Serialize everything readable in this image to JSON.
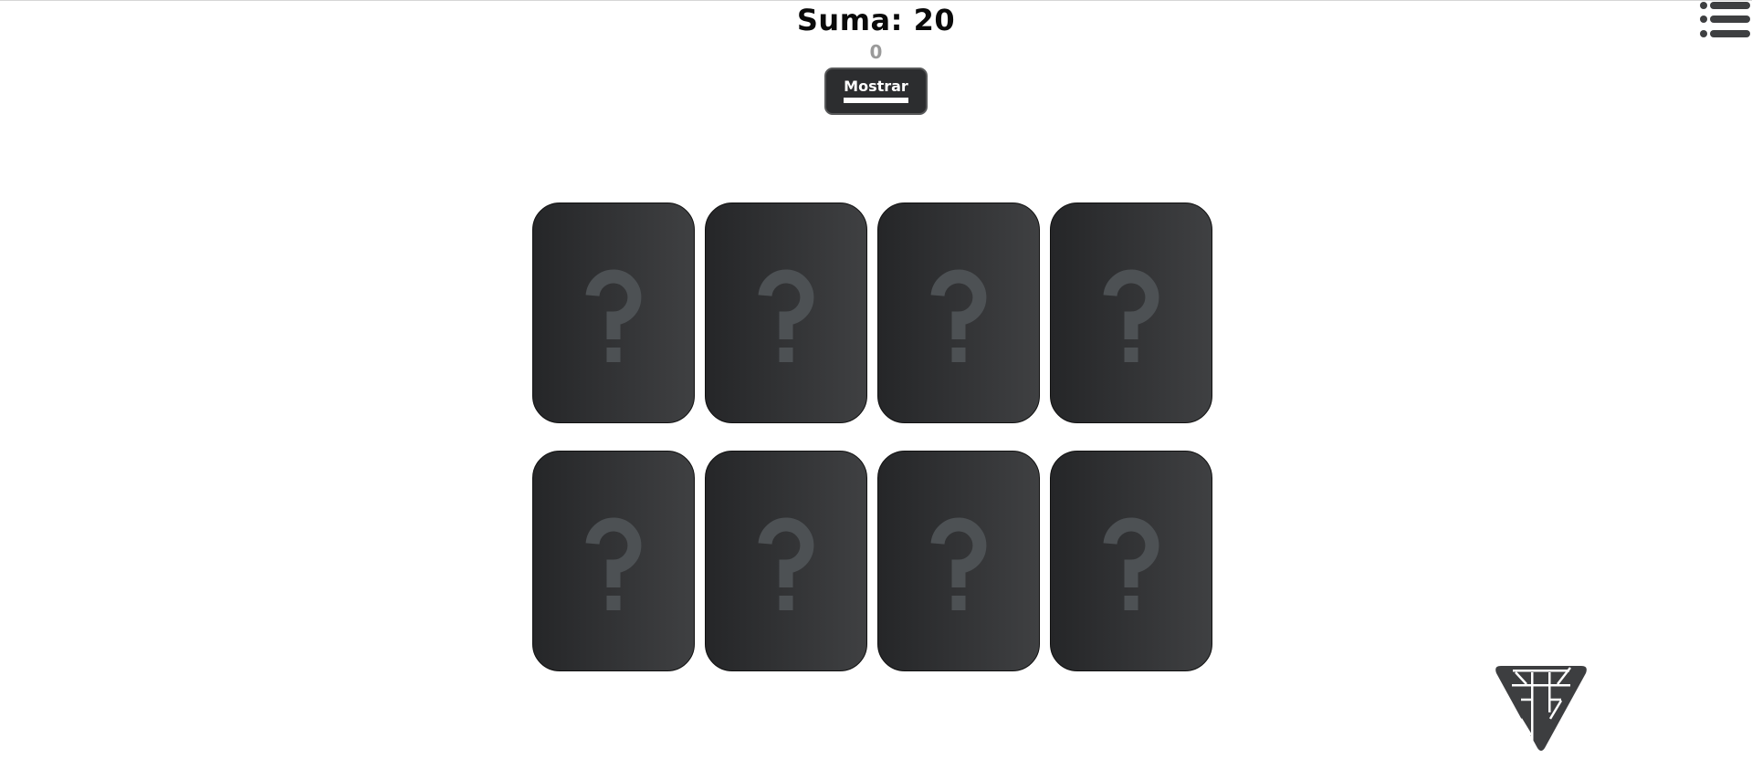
{
  "header": {
    "title": "Suma: 20",
    "counter": "0",
    "show_button_label": "Mostrar"
  },
  "menu": {
    "icon": "hamburger-menu-icon"
  },
  "cards": [
    {
      "face": "question-mark-icon"
    },
    {
      "face": "question-mark-icon"
    },
    {
      "face": "question-mark-icon"
    },
    {
      "face": "question-mark-icon"
    },
    {
      "face": "question-mark-icon"
    },
    {
      "face": "question-mark-icon"
    },
    {
      "face": "question-mark-icon"
    },
    {
      "face": "question-mark-icon"
    }
  ],
  "colors": {
    "card_gradient_start": "#252628",
    "card_gradient_end": "#3f4042",
    "question_mark": "#4d5154",
    "button_bg": "#2c2d2f",
    "counter_text": "#9a9a9a",
    "logo": "#3d3e40"
  },
  "logo": {
    "icon": "brand-logo-icon"
  }
}
